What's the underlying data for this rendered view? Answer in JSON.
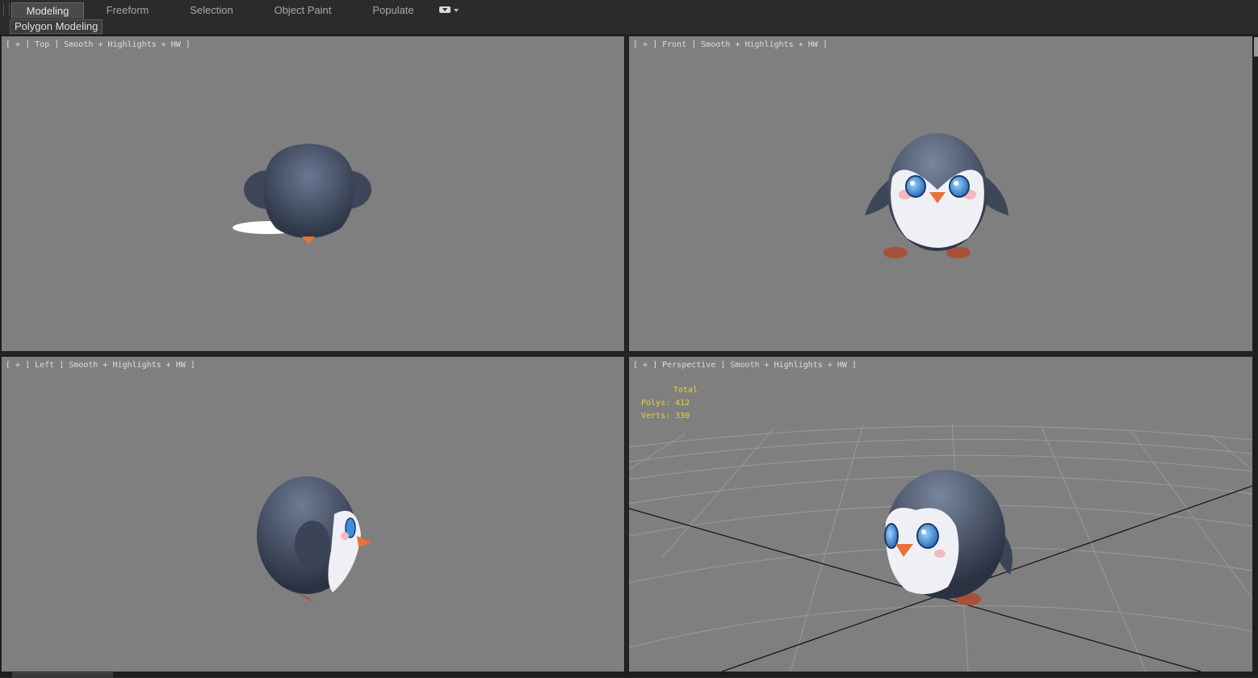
{
  "ribbon": {
    "tabs": [
      {
        "label": "Modeling",
        "active": true
      },
      {
        "label": "Freeform",
        "active": false
      },
      {
        "label": "Selection",
        "active": false
      },
      {
        "label": "Object Paint",
        "active": false
      },
      {
        "label": "Populate",
        "active": false
      }
    ],
    "panel_label": "Polygon Modeling"
  },
  "viewports": {
    "top": {
      "label": "[ + ] Top ] Smooth + Highlights + HW ]"
    },
    "front": {
      "label": "[ + ] Front ] Smooth + Highlights + HW ]"
    },
    "left": {
      "label": "[ + ] Left ] Smooth + Highlights + HW ]"
    },
    "perspective": {
      "label": "[ + ] Perspective ] Smooth + Highlights + HW ]"
    }
  },
  "stats": {
    "header": "Total",
    "polys_label": "Polys:",
    "polys_value": "412",
    "verts_label": "Verts:",
    "verts_value": "330"
  },
  "colors": {
    "viewport_bg": "#7f7f7f",
    "stats_text": "#e8d23a",
    "penguin_body": "#3b4556",
    "penguin_belly": "#eef0f6",
    "penguin_beak": "#e8733a",
    "penguin_eye": "#3f8fd8"
  }
}
